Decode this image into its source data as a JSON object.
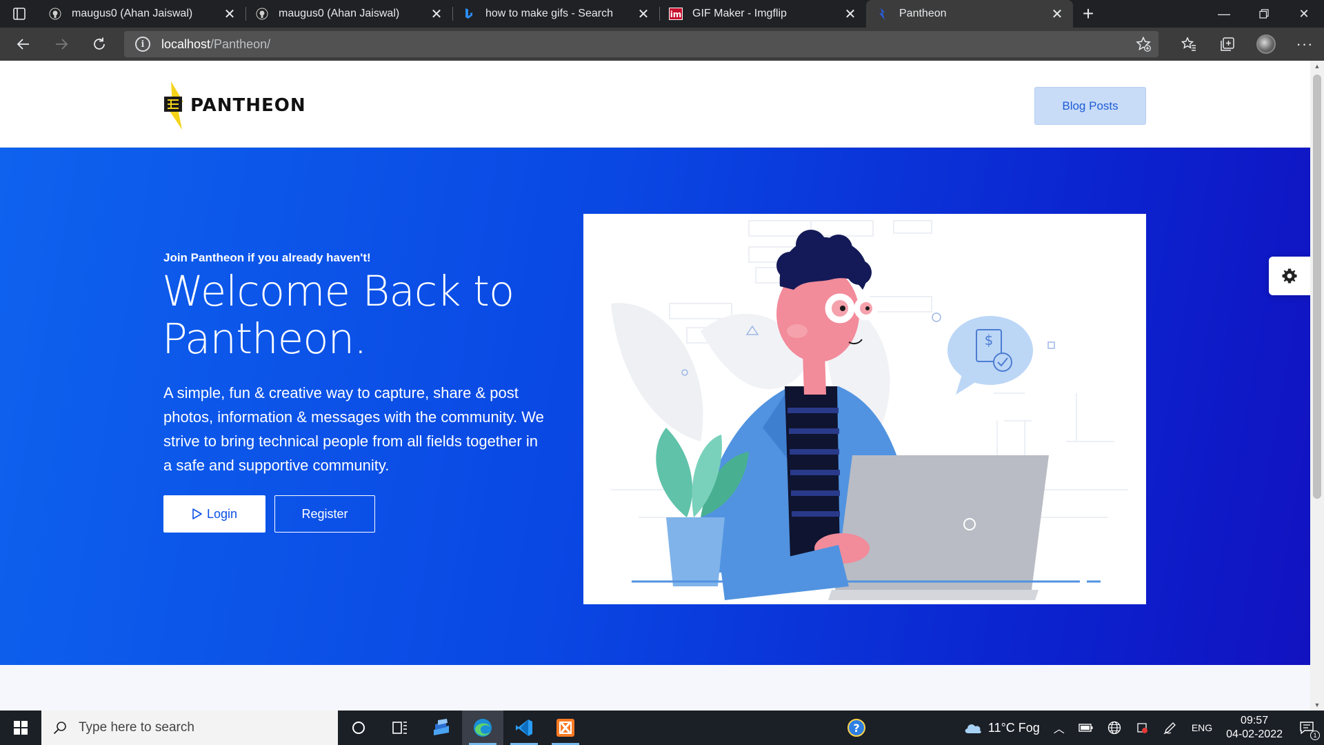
{
  "browser": {
    "tabs": [
      {
        "title": "maugus0 (Ahan Jaiswal)",
        "icon": "github-icon"
      },
      {
        "title": "maugus0 (Ahan Jaiswal)",
        "icon": "github-icon"
      },
      {
        "title": "how to make gifs - Search",
        "icon": "bing-icon"
      },
      {
        "title": "GIF Maker - Imgflip",
        "icon": "imgflip-icon"
      },
      {
        "title": "Pantheon",
        "icon": "pantheon-icon",
        "active": true
      }
    ],
    "address": {
      "host": "localhost",
      "path": "/Pantheon/"
    }
  },
  "site": {
    "logo_text": "PANTHEON",
    "nav_button": "Blog Posts",
    "hero": {
      "eyebrow": "Join Pantheon if you already haven't!",
      "title_line1": "Welcome Back to",
      "title_line2": "Pantheon.",
      "description": "A simple, fun & creative way to capture, share & post photos, information & messages with the community. We strive to bring technical people from all fields together in a safe and supportive community.",
      "login_label": "Login",
      "register_label": "Register"
    }
  },
  "taskbar": {
    "search_placeholder": "Type here to search",
    "weather": "11°C Fog",
    "language": "ENG",
    "time": "09:57",
    "date": "04-02-2022",
    "notification_count": "1"
  },
  "colors": {
    "hero_start": "#0e62ee",
    "hero_end": "#1212c0",
    "blog_button_bg": "#c8dcf8",
    "blog_button_text": "#1e5bd3"
  }
}
